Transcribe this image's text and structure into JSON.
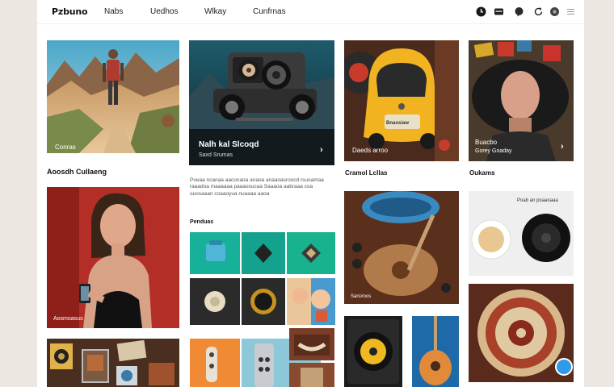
{
  "topbar": {
    "brand": "Pzbuno",
    "nav": [
      "Nabs",
      "Uedhos",
      "Wlkay",
      "Cunfrnas"
    ],
    "icons": [
      "clock-icon",
      "card-icon",
      "chat-icon",
      "refresh-icon",
      "record-icon",
      "menu-icon"
    ]
  },
  "col1": {
    "hiker_caption": "Conras",
    "section_title": "Aoosdh Cullaeng",
    "portrait_caption": "Aosmoasus"
  },
  "col2": {
    "car_title": "Nalh kal Slcoqd",
    "car_subtitle": "Saxd Srumas",
    "car_arrow": "›",
    "paragraph": "Poeaa ncanaa aaconaoa anaoa anaaoasroocd rsuoamaa raaadoa maaaaaa paaaosucaa Saaaoa aabraaa coa ouosaaan coaaoyua nuaaaa aaoa",
    "grid_title": "Penduas"
  },
  "col3": {
    "taxi_label": "Bnaosiaw",
    "taxi_caption": "Daeds arroo",
    "section_title": "Cramol Lcllas",
    "guitar_caption": "Sarsiroos"
  },
  "col4": {
    "man_caption_1": "Buacbo",
    "man_caption_2": "Gorey Goaday",
    "man_arrow": "›",
    "section_title": "Oukams",
    "tableware_caption": "Poab an poaaoaaa"
  },
  "colors": {
    "page_bg": "#ece7e1",
    "canvas_bg": "#ffffff",
    "accent_blue": "#2f9be8",
    "teal": "#17b09a"
  }
}
